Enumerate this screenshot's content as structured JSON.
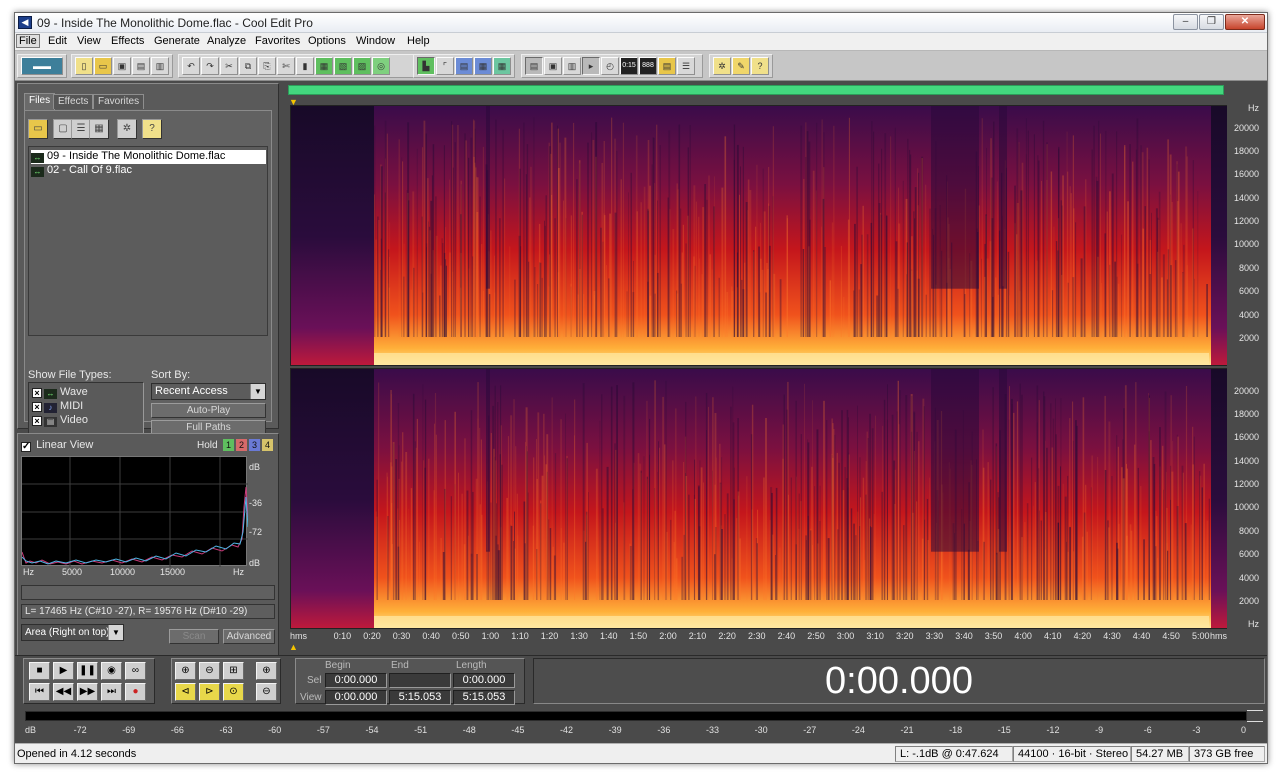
{
  "window": {
    "title": "09 - Inside The Monolithic Dome.flac - Cool Edit Pro",
    "min_glyph": "–",
    "max_glyph": "❐",
    "close_glyph": "✕"
  },
  "menu": [
    "File",
    "Edit",
    "View",
    "Effects",
    "Generate",
    "Analyze",
    "Favorites",
    "Options",
    "Window",
    "Help"
  ],
  "toolbar": {
    "button_icons": [
      "multitrack-toggle-icon",
      "new-file-icon",
      "open-file-icon",
      "save-icon",
      "save-all-icon",
      "save-selection-icon",
      "undo-icon",
      "redo-icon",
      "repeat-icon",
      "copy-icon",
      "paste-icon",
      "cut-icon",
      "trim-icon",
      "mix-paste-icon",
      "silence-icon",
      "invert-icon",
      "sync-icon",
      "time-stretch-icon",
      "waveform-view-icon",
      "spectral-view-icon",
      "edit-left-icon",
      "edit-right-icon",
      "edit-both-icon",
      "grid-icon",
      "snap-icon",
      "cue-list-icon",
      "play-list-icon",
      "zoom-icon",
      "time-display-icon",
      "frequency-icon",
      "mark-icon",
      "setup-icon",
      "effects-icon",
      "options-icon",
      "help-icon"
    ]
  },
  "files_panel": {
    "tabs": [
      "Files",
      "Effects",
      "Favorites"
    ],
    "active_tab": "Files",
    "files": [
      "09 - Inside The Monolithic Dome.flac",
      "02 - Call Of 9.flac"
    ],
    "selected_index": 0,
    "show_file_types_label": "Show File Types:",
    "file_types": [
      {
        "label": "Wave",
        "checked": true
      },
      {
        "label": "MIDI",
        "checked": true
      },
      {
        "label": "Video",
        "checked": true
      }
    ],
    "sort_by_label": "Sort By:",
    "sort_by_value": "Recent Access",
    "auto_play_label": "Auto-Play",
    "full_paths_label": "Full Paths"
  },
  "analysis_panel": {
    "linear_view_label": "Linear View",
    "linear_view_checked": true,
    "hold_label": "Hold",
    "hold_buttons": [
      {
        "label": "1",
        "color": "#5fbf5f"
      },
      {
        "label": "2",
        "color": "#d66a6a"
      },
      {
        "label": "3",
        "color": "#6a7ad6"
      },
      {
        "label": "4",
        "color": "#d6c36a"
      }
    ],
    "db_labels": [
      "dB",
      "-36",
      "-72",
      "dB"
    ],
    "hz_labels": [
      "Hz",
      "5000",
      "10000",
      "15000",
      "Hz"
    ],
    "readout": "L=  17465 Hz (C#10 -27), R=  19576 Hz (D#10 -29)",
    "area_select": "Area (Right on top)",
    "scan_label": "Scan",
    "advanced_label": "Advanced"
  },
  "spectral": {
    "hz_labels": [
      "Hz",
      "20000",
      "18000",
      "16000",
      "14000",
      "12000",
      "10000",
      "8000",
      "6000",
      "4000",
      "2000"
    ],
    "hz_labels_bottom": [
      "20000",
      "18000",
      "16000",
      "14000",
      "12000",
      "10000",
      "8000",
      "6000",
      "4000",
      "2000",
      "Hz"
    ],
    "time_labels": [
      "hms",
      "0:10",
      "0:20",
      "0:30",
      "0:40",
      "0:50",
      "1:00",
      "1:10",
      "1:20",
      "1:30",
      "1:40",
      "1:50",
      "2:00",
      "2:10",
      "2:20",
      "2:30",
      "2:40",
      "2:50",
      "3:00",
      "3:10",
      "3:20",
      "3:30",
      "3:40",
      "3:50",
      "4:00",
      "4:10",
      "4:20",
      "4:30",
      "4:40",
      "4:50",
      "5:00",
      "hms"
    ]
  },
  "transport": {
    "headers": {
      "begin": "Begin",
      "end": "End",
      "length": "Length"
    },
    "sel_label": "Sel",
    "view_label": "View",
    "sel_begin": "0:00.000",
    "sel_end": "",
    "sel_length": "0:00.000",
    "view_begin": "0:00.000",
    "view_end": "5:15.053",
    "view_length": "5:15.053",
    "time_display": "0:00.000"
  },
  "level_meter": {
    "labels": [
      "dB",
      "-72",
      "-69",
      "-66",
      "-63",
      "-60",
      "-57",
      "-54",
      "-51",
      "-48",
      "-45",
      "-42",
      "-39",
      "-36",
      "-33",
      "-30",
      "-27",
      "-24",
      "-21",
      "-18",
      "-15",
      "-12",
      "-9",
      "-6",
      "-3",
      "0"
    ]
  },
  "status": {
    "message": "Opened in 4.12 seconds",
    "level": "L: -.1dB @  0:47.624",
    "format": "44100 · 16-bit · Stereo",
    "size": "54.27 MB",
    "free": "373 GB free"
  },
  "colors": {
    "overview": "#43d77e",
    "spec_low": "#1a0a2a",
    "spec_mid": "#c4161c",
    "spec_high": "#ffe28a"
  }
}
